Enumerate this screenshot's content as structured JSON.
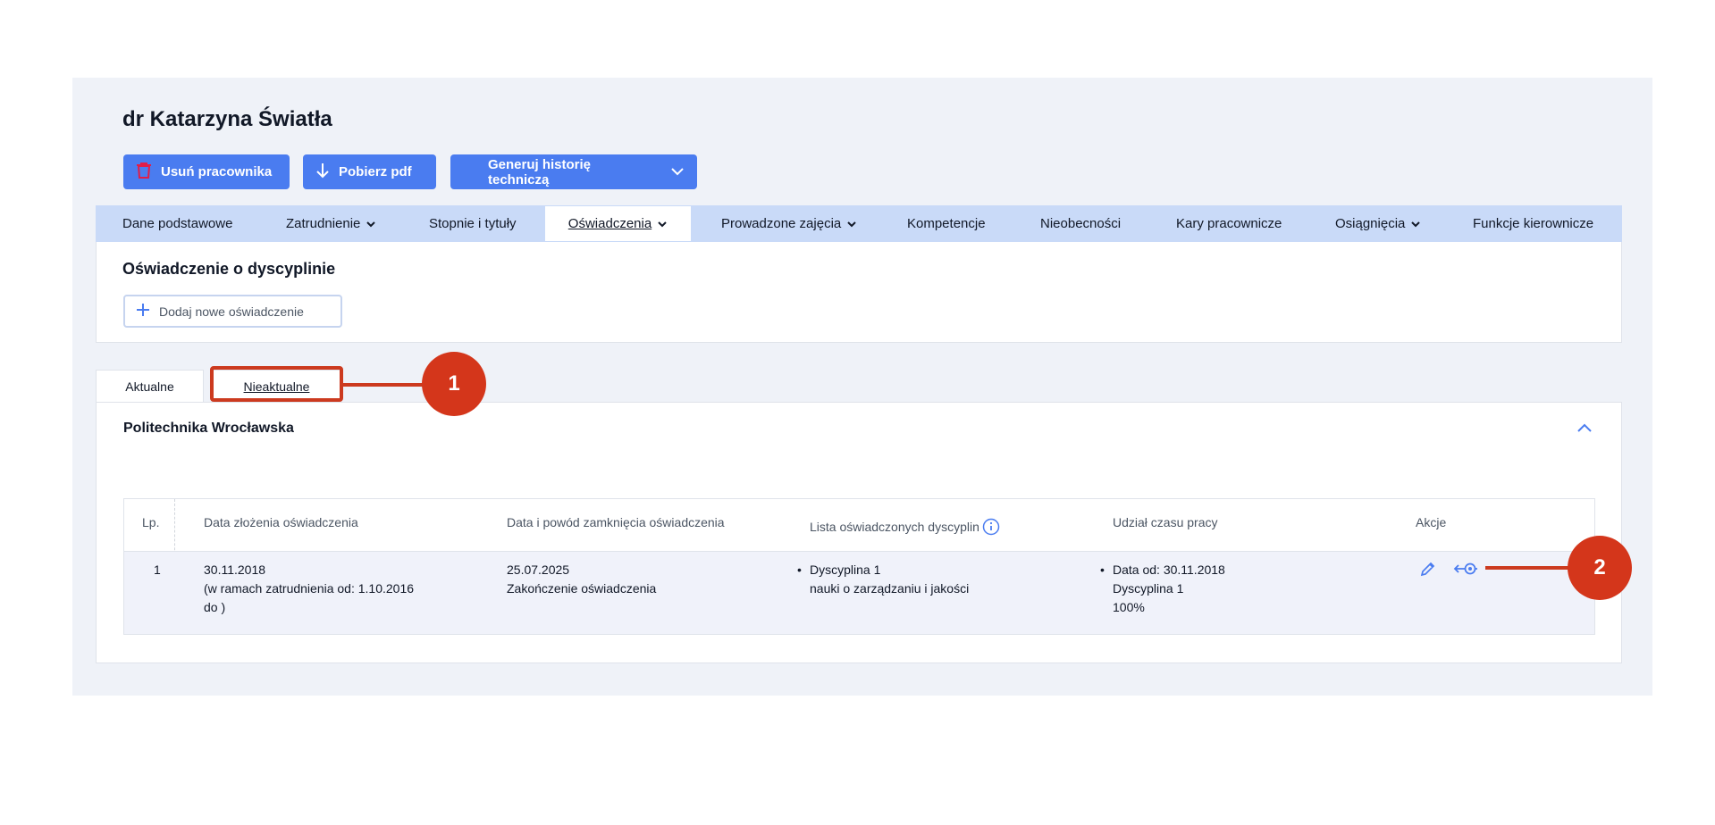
{
  "header": {
    "title": "dr Katarzyna Światła"
  },
  "actions": {
    "delete_label": "Usuń pracownika",
    "pdf_label": "Pobierz pdf",
    "history_label": "Generuj historię techniczą"
  },
  "nav_tabs": [
    {
      "label": "Dane podstawowe"
    },
    {
      "label": "Zatrudnienie"
    },
    {
      "label": "Stopnie i tytuły"
    },
    {
      "label": "Oświadczenia"
    },
    {
      "label": "Prowadzone zajęcia"
    },
    {
      "label": "Kompetencje"
    },
    {
      "label": "Nieobecności"
    },
    {
      "label": "Kary pracownicze"
    },
    {
      "label": "Osiągnięcia"
    },
    {
      "label": "Funkcje kierownicze"
    }
  ],
  "section": {
    "title": "Oświadczenie o dyscyplinie",
    "add_label": "Dodaj nowe oświadczenie"
  },
  "sub_tabs": {
    "current": "Aktualne",
    "outdated": "Nieaktualne"
  },
  "group": {
    "title": "Politechnika Wrocławska"
  },
  "table": {
    "headers": {
      "lp": "Lp.",
      "date": "Data złożenia oświadczenia",
      "closing": "Data i powód zamknięcia oświadczenia",
      "disciplines": "Lista oświadczonych dyscyplin",
      "share": "Udział czasu pracy",
      "actions": "Akcje"
    },
    "rows": [
      {
        "lp": "1",
        "date": "30.11.2018",
        "date_note": "(w ramach zatrudnienia od: 1.10.2016",
        "date_note2": "do )",
        "closing_date": "25.07.2025",
        "closing_reason": "Zakończenie oświadczenia",
        "discipline_name": "Dyscyplina 1",
        "discipline_field": "nauki o zarządzaniu i jakości",
        "share_from": "Data od: 30.11.2018",
        "share_discipline": "Dyscyplina 1",
        "share_percent": "100%"
      }
    ]
  },
  "callouts": {
    "one": "1",
    "two": "2"
  },
  "colors": {
    "primary": "#4a7cf0",
    "tab_bar": "#c9daf8",
    "panel": "#eff2f8",
    "callout": "#d4361b",
    "delete_icon": "#e11d48"
  }
}
